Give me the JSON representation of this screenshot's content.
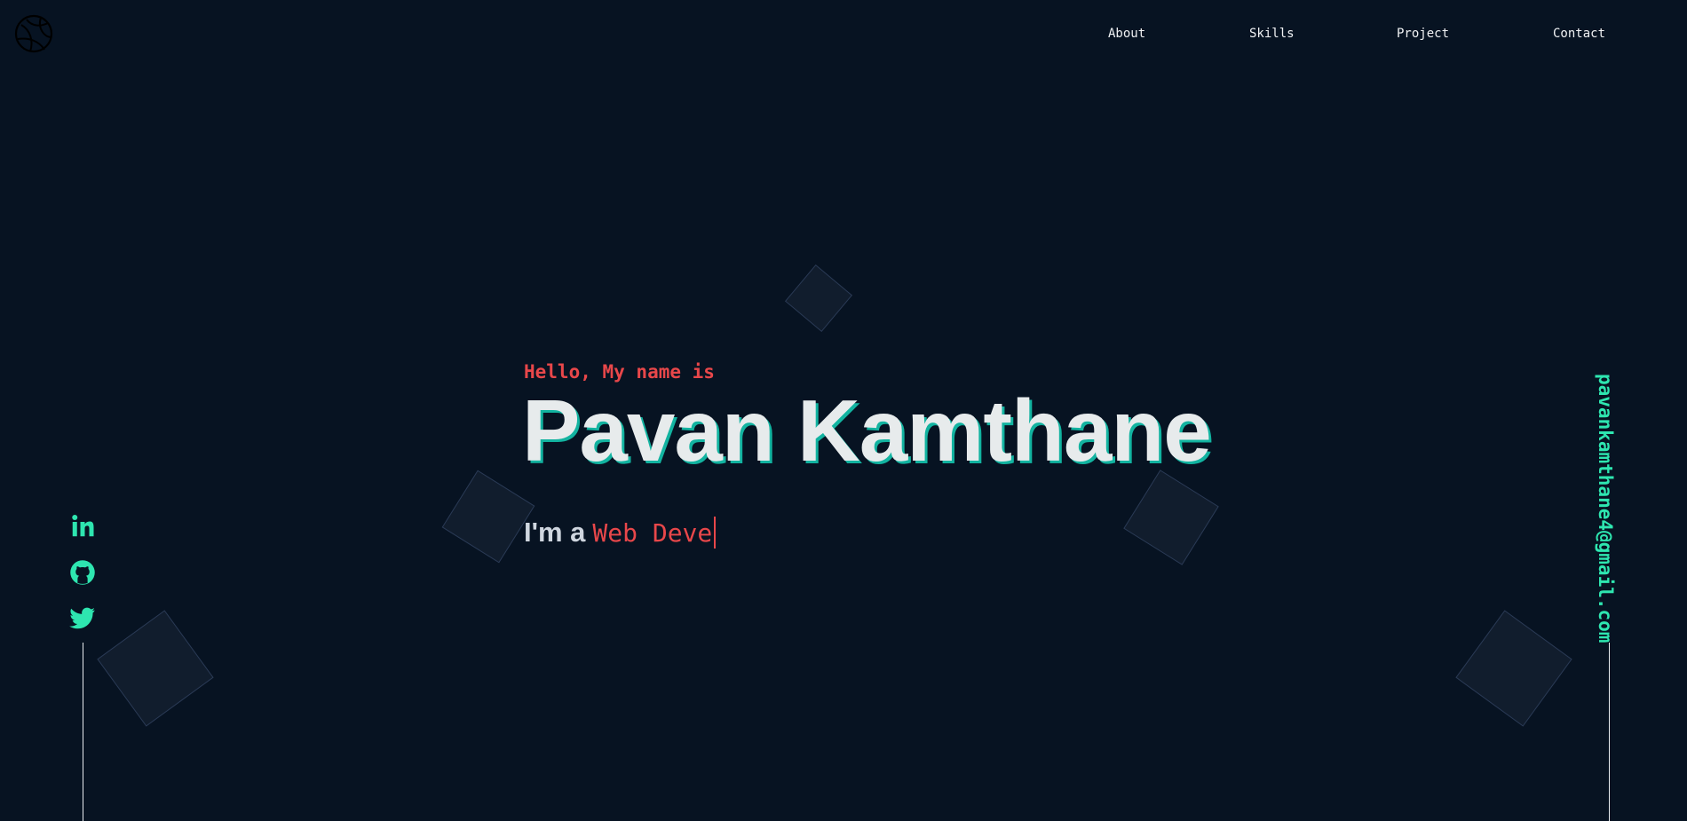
{
  "nav": {
    "items": [
      {
        "label": "About"
      },
      {
        "label": "Skills"
      },
      {
        "label": "Project"
      },
      {
        "label": "Contact"
      }
    ]
  },
  "logo": {
    "icon": "logo-icon"
  },
  "hero": {
    "greeting": "Hello, My name is",
    "name": "Pavan Kamthane",
    "tagline_prefix": "I'm a",
    "tagline_role": "Web Deve"
  },
  "social": {
    "items": [
      {
        "icon": "linkedin-icon"
      },
      {
        "icon": "github-icon"
      },
      {
        "icon": "twitter-icon"
      }
    ]
  },
  "contact": {
    "email": "pavankamthane4@gmail.com"
  },
  "colors": {
    "background": "#071322",
    "accent_red": "#e8474a",
    "accent_green": "#2ee6b0",
    "name_shadow": "#12b3a0"
  }
}
